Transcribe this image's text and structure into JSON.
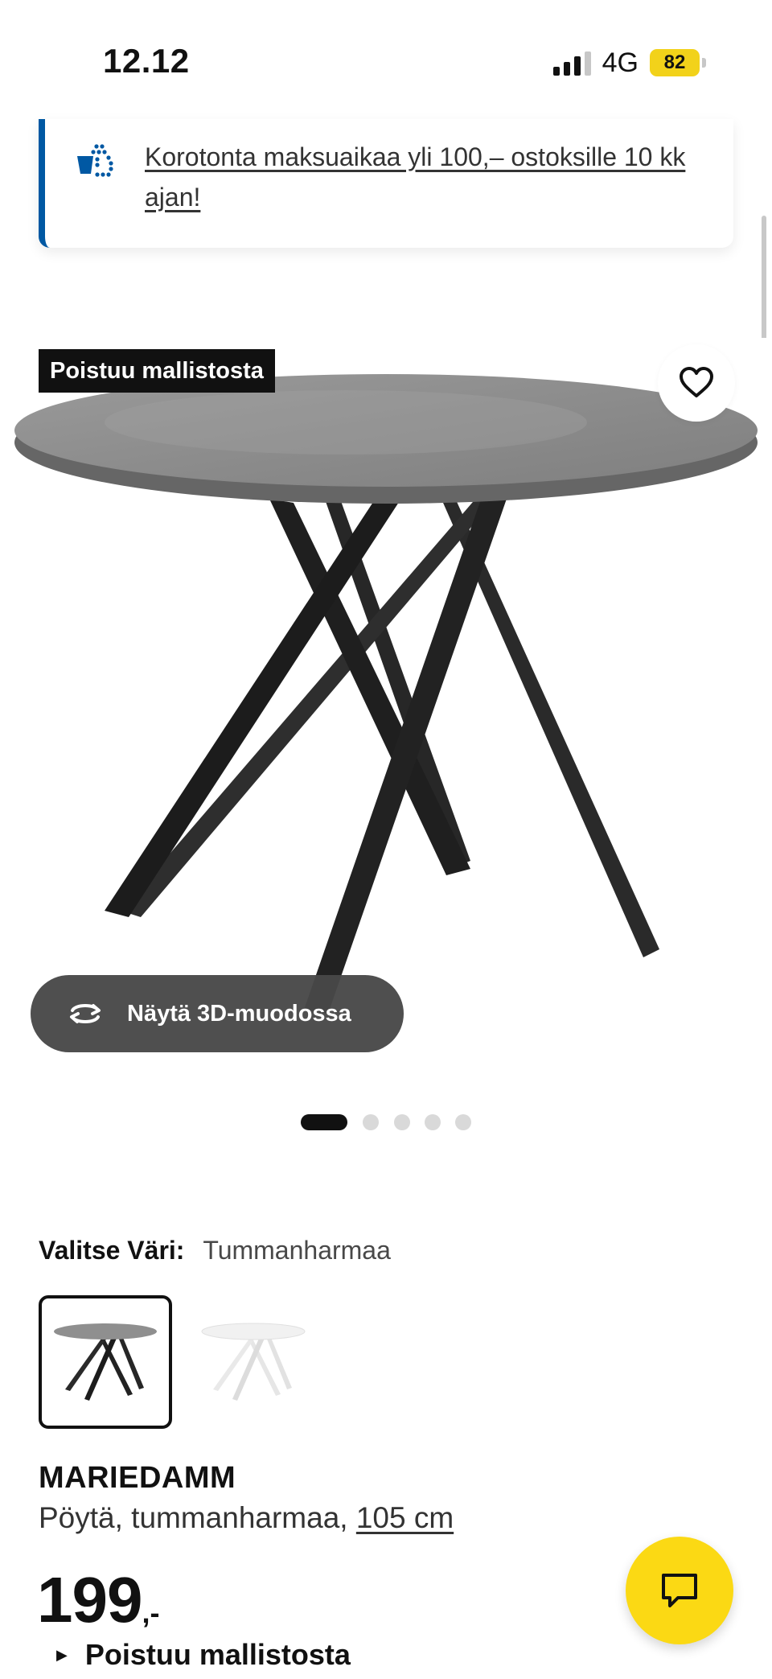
{
  "status_bar": {
    "time": "12.12",
    "network": "4G",
    "battery": "82"
  },
  "banner": {
    "text": "Korotonta maksuaikaa yli 100,– ostoksille 10 kk ajan!",
    "icon": "payment-installment-icon"
  },
  "product_image": {
    "badge": "Poistuu mallistosta",
    "view_3d_label": "Näytä 3D-muodossa",
    "pager": {
      "total": 5,
      "active": 1
    }
  },
  "color_selector": {
    "label": "Valitse Väri:",
    "selected_value": "Tummanharmaa",
    "options": [
      "Tummanharmaa",
      "Valkoinen"
    ]
  },
  "product": {
    "name": "MARIEDAMM",
    "description": "Pöytä, tummanharmaa, ",
    "size": "105 cm",
    "price": "199",
    "price_suffix": ",-",
    "availability": "Poistuu mallistosta"
  },
  "colors": {
    "accent_blue": "#0058a3",
    "brand_yellow": "#fbd914",
    "badge_black": "#111111"
  }
}
